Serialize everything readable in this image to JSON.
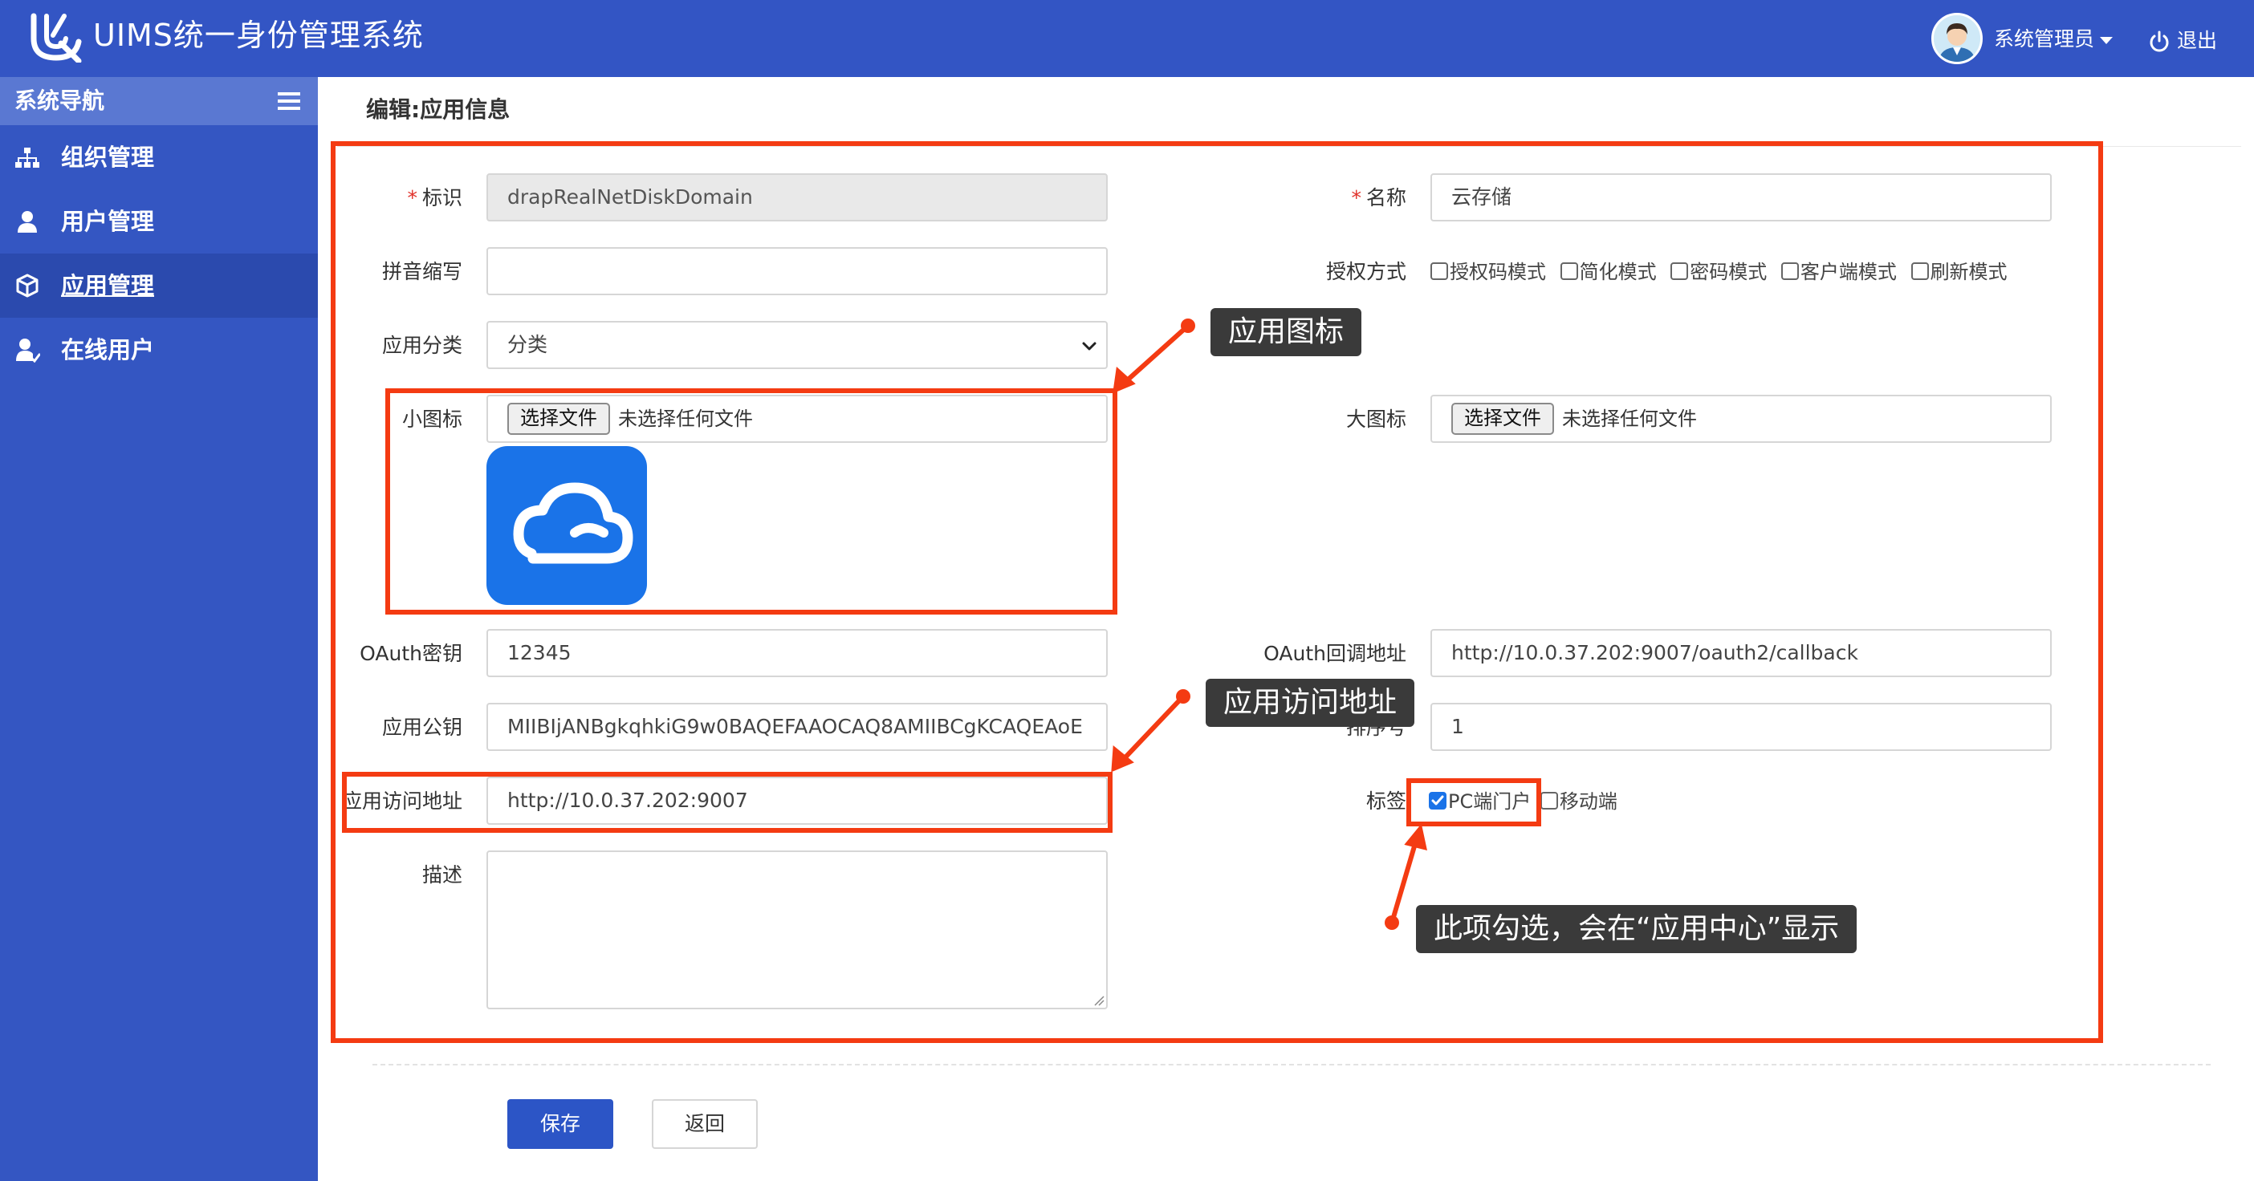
{
  "header": {
    "app_title": "UIMS统一身份管理系统",
    "user_name": "系统管理员",
    "logout_label": "退出",
    "icons": [
      "logo-mark-icon",
      "avatar",
      "caret-down-icon",
      "power-icon"
    ]
  },
  "sidebar": {
    "title": "系统导航",
    "items": [
      {
        "label": "组织管理",
        "icon": "org-tree-icon"
      },
      {
        "label": "用户管理",
        "icon": "user-icon"
      },
      {
        "label": "应用管理",
        "icon": "cube-icon",
        "active": true
      },
      {
        "label": "在线用户",
        "icon": "online-user-icon"
      }
    ]
  },
  "main": {
    "page_title": "编辑:应用信息",
    "form": {
      "identifier": {
        "label": "标识",
        "required_mark": "*",
        "value": "drapRealNetDiskDomain"
      },
      "name": {
        "label": "名称",
        "required_mark": "*",
        "value": "云存储"
      },
      "pinyin": {
        "label": "拼音缩写",
        "value": ""
      },
      "auth_mode": {
        "label": "授权方式",
        "options": [
          {
            "label": "授权码模式",
            "checked": false
          },
          {
            "label": "简化模式",
            "checked": false
          },
          {
            "label": "密码模式",
            "checked": false
          },
          {
            "label": "客户端模式",
            "checked": false
          },
          {
            "label": "刷新模式",
            "checked": false
          }
        ]
      },
      "category": {
        "label": "应用分类",
        "selected": "分类"
      },
      "small_icon": {
        "label": "小图标",
        "button": "选择文件",
        "status": "未选择任何文件"
      },
      "large_icon": {
        "label": "大图标",
        "button": "选择文件",
        "status": "未选择任何文件"
      },
      "oauth_secret": {
        "label": "OAuth密钥",
        "value": "12345"
      },
      "oauth_callback": {
        "label": "OAuth回调地址",
        "value": "http://10.0.37.202:9007/oauth2/callback"
      },
      "public_key": {
        "label": "应用公钥",
        "value": "MIIBIjANBgkqhkiG9w0BAQEFAAOCAQ8AMIIBCgKCAQEAoE"
      },
      "sort_order": {
        "label": "排序号",
        "value": "1"
      },
      "access_url": {
        "label": "应用访问地址",
        "value": "http://10.0.37.202:9007"
      },
      "tags": {
        "label": "标签",
        "options": [
          {
            "label": "PC端门户",
            "checked": true
          },
          {
            "label": "移动端",
            "checked": false
          }
        ]
      },
      "description": {
        "label": "描述",
        "value": ""
      }
    },
    "buttons": {
      "save": "保存",
      "back": "返回"
    }
  },
  "annotations": {
    "app_icon_callout": "应用图标",
    "access_url_callout": "应用访问地址",
    "tag_callout": "此项勾选，会在“应用中心”显示",
    "accent_color": "#f43b12"
  },
  "colors": {
    "brand": "#3355c4",
    "sidebar": "#3456c2",
    "sidebar_active": "#2b4aae",
    "save_button": "#2c55c6",
    "icon_tile": "#1a73e8"
  }
}
